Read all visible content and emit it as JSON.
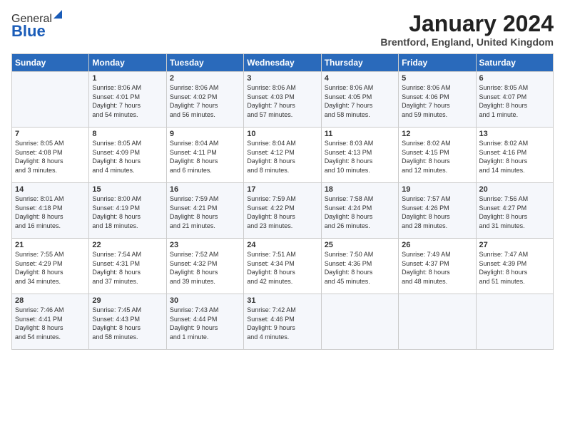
{
  "header": {
    "logo_general": "General",
    "logo_blue": "Blue",
    "month_title": "January 2024",
    "location": "Brentford, England, United Kingdom"
  },
  "days_of_week": [
    "Sunday",
    "Monday",
    "Tuesday",
    "Wednesday",
    "Thursday",
    "Friday",
    "Saturday"
  ],
  "weeks": [
    [
      {
        "day": "",
        "info": ""
      },
      {
        "day": "1",
        "info": "Sunrise: 8:06 AM\nSunset: 4:01 PM\nDaylight: 7 hours\nand 54 minutes."
      },
      {
        "day": "2",
        "info": "Sunrise: 8:06 AM\nSunset: 4:02 PM\nDaylight: 7 hours\nand 56 minutes."
      },
      {
        "day": "3",
        "info": "Sunrise: 8:06 AM\nSunset: 4:03 PM\nDaylight: 7 hours\nand 57 minutes."
      },
      {
        "day": "4",
        "info": "Sunrise: 8:06 AM\nSunset: 4:05 PM\nDaylight: 7 hours\nand 58 minutes."
      },
      {
        "day": "5",
        "info": "Sunrise: 8:06 AM\nSunset: 4:06 PM\nDaylight: 7 hours\nand 59 minutes."
      },
      {
        "day": "6",
        "info": "Sunrise: 8:05 AM\nSunset: 4:07 PM\nDaylight: 8 hours\nand 1 minute."
      }
    ],
    [
      {
        "day": "7",
        "info": "Sunrise: 8:05 AM\nSunset: 4:08 PM\nDaylight: 8 hours\nand 3 minutes."
      },
      {
        "day": "8",
        "info": "Sunrise: 8:05 AM\nSunset: 4:09 PM\nDaylight: 8 hours\nand 4 minutes."
      },
      {
        "day": "9",
        "info": "Sunrise: 8:04 AM\nSunset: 4:11 PM\nDaylight: 8 hours\nand 6 minutes."
      },
      {
        "day": "10",
        "info": "Sunrise: 8:04 AM\nSunset: 4:12 PM\nDaylight: 8 hours\nand 8 minutes."
      },
      {
        "day": "11",
        "info": "Sunrise: 8:03 AM\nSunset: 4:13 PM\nDaylight: 8 hours\nand 10 minutes."
      },
      {
        "day": "12",
        "info": "Sunrise: 8:02 AM\nSunset: 4:15 PM\nDaylight: 8 hours\nand 12 minutes."
      },
      {
        "day": "13",
        "info": "Sunrise: 8:02 AM\nSunset: 4:16 PM\nDaylight: 8 hours\nand 14 minutes."
      }
    ],
    [
      {
        "day": "14",
        "info": "Sunrise: 8:01 AM\nSunset: 4:18 PM\nDaylight: 8 hours\nand 16 minutes."
      },
      {
        "day": "15",
        "info": "Sunrise: 8:00 AM\nSunset: 4:19 PM\nDaylight: 8 hours\nand 18 minutes."
      },
      {
        "day": "16",
        "info": "Sunrise: 7:59 AM\nSunset: 4:21 PM\nDaylight: 8 hours\nand 21 minutes."
      },
      {
        "day": "17",
        "info": "Sunrise: 7:59 AM\nSunset: 4:22 PM\nDaylight: 8 hours\nand 23 minutes."
      },
      {
        "day": "18",
        "info": "Sunrise: 7:58 AM\nSunset: 4:24 PM\nDaylight: 8 hours\nand 26 minutes."
      },
      {
        "day": "19",
        "info": "Sunrise: 7:57 AM\nSunset: 4:26 PM\nDaylight: 8 hours\nand 28 minutes."
      },
      {
        "day": "20",
        "info": "Sunrise: 7:56 AM\nSunset: 4:27 PM\nDaylight: 8 hours\nand 31 minutes."
      }
    ],
    [
      {
        "day": "21",
        "info": "Sunrise: 7:55 AM\nSunset: 4:29 PM\nDaylight: 8 hours\nand 34 minutes."
      },
      {
        "day": "22",
        "info": "Sunrise: 7:54 AM\nSunset: 4:31 PM\nDaylight: 8 hours\nand 37 minutes."
      },
      {
        "day": "23",
        "info": "Sunrise: 7:52 AM\nSunset: 4:32 PM\nDaylight: 8 hours\nand 39 minutes."
      },
      {
        "day": "24",
        "info": "Sunrise: 7:51 AM\nSunset: 4:34 PM\nDaylight: 8 hours\nand 42 minutes."
      },
      {
        "day": "25",
        "info": "Sunrise: 7:50 AM\nSunset: 4:36 PM\nDaylight: 8 hours\nand 45 minutes."
      },
      {
        "day": "26",
        "info": "Sunrise: 7:49 AM\nSunset: 4:37 PM\nDaylight: 8 hours\nand 48 minutes."
      },
      {
        "day": "27",
        "info": "Sunrise: 7:47 AM\nSunset: 4:39 PM\nDaylight: 8 hours\nand 51 minutes."
      }
    ],
    [
      {
        "day": "28",
        "info": "Sunrise: 7:46 AM\nSunset: 4:41 PM\nDaylight: 8 hours\nand 54 minutes."
      },
      {
        "day": "29",
        "info": "Sunrise: 7:45 AM\nSunset: 4:43 PM\nDaylight: 8 hours\nand 58 minutes."
      },
      {
        "day": "30",
        "info": "Sunrise: 7:43 AM\nSunset: 4:44 PM\nDaylight: 9 hours\nand 1 minute."
      },
      {
        "day": "31",
        "info": "Sunrise: 7:42 AM\nSunset: 4:46 PM\nDaylight: 9 hours\nand 4 minutes."
      },
      {
        "day": "",
        "info": ""
      },
      {
        "day": "",
        "info": ""
      },
      {
        "day": "",
        "info": ""
      }
    ]
  ]
}
